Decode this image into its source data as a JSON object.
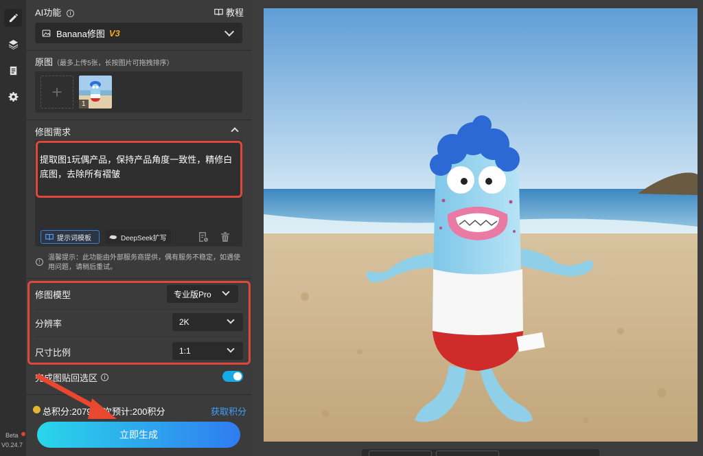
{
  "rail": {
    "items": [
      {
        "name": "edit-icon",
        "active": true
      },
      {
        "name": "layers-icon",
        "active": false
      },
      {
        "name": "clipboard-icon",
        "active": false
      },
      {
        "name": "gear-icon",
        "active": false
      }
    ],
    "beta": "Beta",
    "version": "V0.24.7"
  },
  "panel": {
    "ai_title": "AI功能",
    "tutorial": "教程",
    "model_name": "Banana修图",
    "model_version": "V3",
    "orig_title": "原图",
    "orig_hint": "（最多上传5张，长按图片可拖拽排序）",
    "thumb_index": "1",
    "req_title": "修图需求",
    "req_text": "提取图1玩偶产品，保持产品角度一致性，精修白底图，去除所有褶皱",
    "template_btn": "提示词模板",
    "deepseek_btn": "DeepSeek扩写",
    "tip_text": "温馨提示：此功能由外部服务商提供，偶有服务不稳定，如遇使用问题，请稍后重试。",
    "options": [
      {
        "label": "修图模型",
        "value": "专业版Pro"
      },
      {
        "label": "分辨率",
        "value": "2K"
      },
      {
        "label": "尺寸比例",
        "value": "1:1"
      }
    ],
    "paste_back": "完成图贴回选区",
    "credits_text": "总积分:2079  本次预计:200积分",
    "get_credits": "获取积分",
    "generate": "立即生成"
  },
  "colors": {
    "accent": "#3da0ff",
    "highlight_box": "#e0483c",
    "toggle_on": "#1aa8e6",
    "model_version": "#f5a623"
  }
}
